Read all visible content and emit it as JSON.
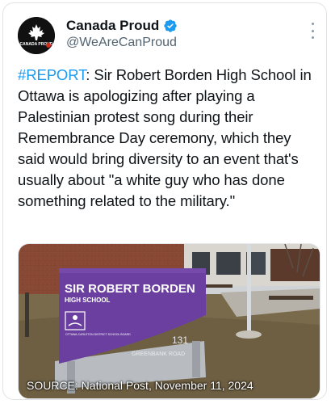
{
  "author": {
    "name": "Canada Proud",
    "handle": "@WeAreCanProud",
    "verified_color": "#1d9bf0",
    "avatar_icon": "maple-leaf-icon",
    "avatar_text": "CANADA PROUD"
  },
  "menu_icon": "more-vertical-icon",
  "tweet": {
    "hashtag": "#REPORT",
    "body": ": Sir Robert Borden High School in Ottawa is apologizing after playing a Palestinian protest song during their Remembrance Day ceremony, which they said would bring diversity to an event that's usually about \"a white guy who has done something related to the military.\""
  },
  "media": {
    "sign_title": "SIR ROBERT BORDEN",
    "sign_subtitle": "HIGH SCHOOL",
    "board_text": "OTTAWA-CARLETON DISTRICT SCHOOL BOARD",
    "street_number": "131",
    "street_name": "GREENBANK ROAD",
    "caption": "SOURCE: National Post, November 11, 2024",
    "sign_color": "#6b3fa0"
  }
}
